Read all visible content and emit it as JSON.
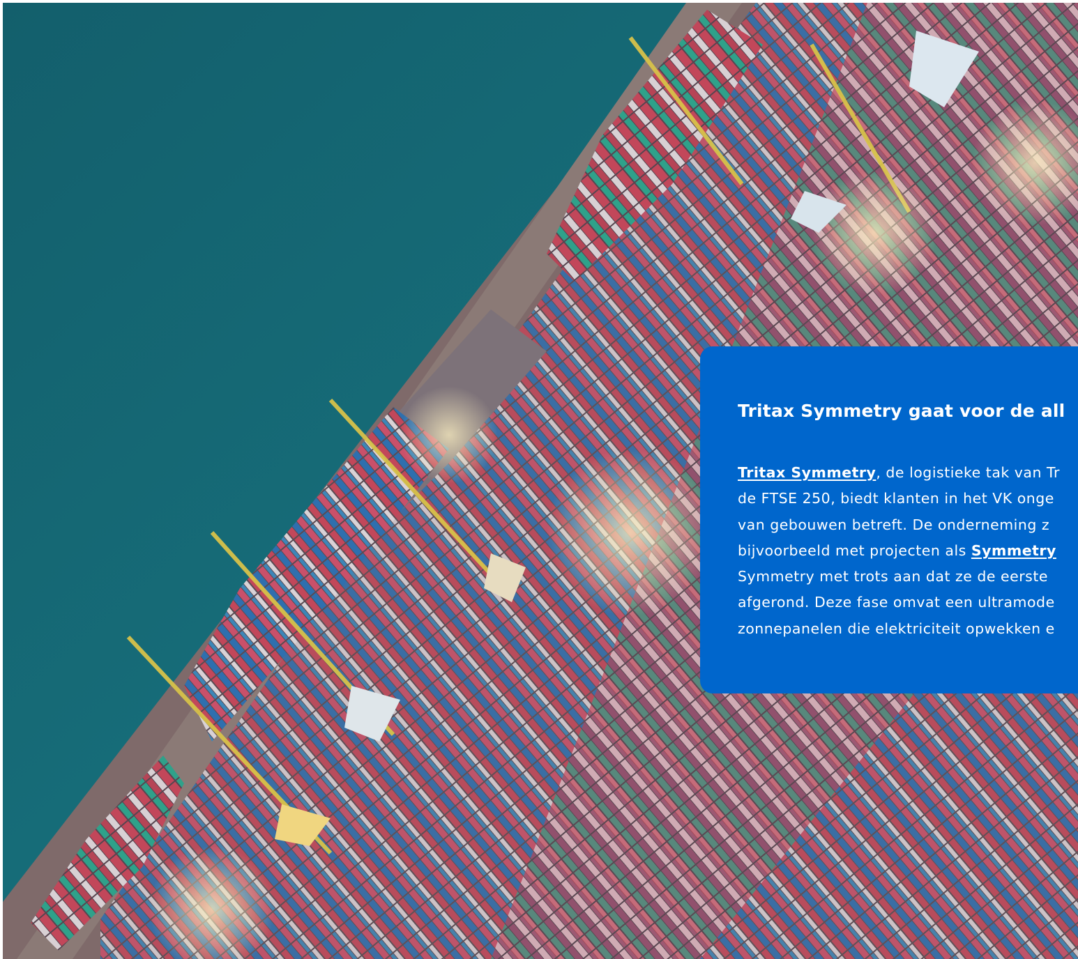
{
  "hero": {
    "image": "aerial-container-port",
    "colors": {
      "sea": "#186f7a",
      "quay": "#8a7672",
      "container_red": "#c2475a",
      "container_blue": "#2f6fae",
      "container_teal": "#2fa18a",
      "crane_yellow": "#d7c24a"
    }
  },
  "card": {
    "background": "#0066cc",
    "title": "Tritax Symmetry gaat voor de all",
    "body": {
      "line1_link": "Tritax Symmetry",
      "line1_rest": ", de logistieke tak van Tr",
      "line2": "de FTSE 250, biedt klanten in het VK onge",
      "line3": "van gebouwen betreft. De onderneming z",
      "line4_text": "bijvoorbeeld met projecten als ",
      "line4_link": "Symmetry",
      "line5": "Symmetry met trots aan dat ze de eerste",
      "line6": "afgerond. Deze fase omvat een ultramode",
      "line7": "zonnepanelen die elektriciteit opwekken e"
    }
  }
}
